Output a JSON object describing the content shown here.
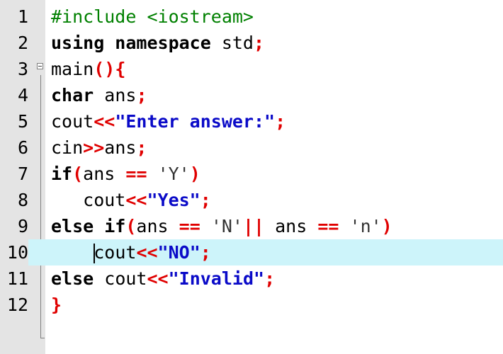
{
  "editor": {
    "current_line": 10,
    "lines": [
      {
        "num": "1",
        "tokens": [
          {
            "t": "pp",
            "v": "#include <iostream>"
          }
        ]
      },
      {
        "num": "2",
        "tokens": [
          {
            "t": "kw",
            "v": "using namespace"
          },
          {
            "t": "plain",
            "v": " std"
          },
          {
            "t": "op",
            "v": ";"
          }
        ]
      },
      {
        "num": "3",
        "tokens": [
          {
            "t": "plain",
            "v": "main"
          },
          {
            "t": "op",
            "v": "(){"
          }
        ]
      },
      {
        "num": "4",
        "tokens": [
          {
            "t": "kw",
            "v": "char"
          },
          {
            "t": "plain",
            "v": " ans"
          },
          {
            "t": "op",
            "v": ";"
          }
        ]
      },
      {
        "num": "5",
        "tokens": [
          {
            "t": "plain",
            "v": "cout"
          },
          {
            "t": "op",
            "v": "<<"
          },
          {
            "t": "str",
            "v": "\"Enter answer:\""
          },
          {
            "t": "op",
            "v": ";"
          }
        ]
      },
      {
        "num": "6",
        "tokens": [
          {
            "t": "plain",
            "v": "cin"
          },
          {
            "t": "op",
            "v": ">>"
          },
          {
            "t": "plain",
            "v": "ans"
          },
          {
            "t": "op",
            "v": ";"
          }
        ]
      },
      {
        "num": "7",
        "tokens": [
          {
            "t": "kw",
            "v": "if"
          },
          {
            "t": "op",
            "v": "("
          },
          {
            "t": "plain",
            "v": "ans "
          },
          {
            "t": "op",
            "v": "=="
          },
          {
            "t": "plain",
            "v": " "
          },
          {
            "t": "chr",
            "v": "'Y'"
          },
          {
            "t": "op",
            "v": ")"
          }
        ]
      },
      {
        "num": "8",
        "tokens": [
          {
            "t": "plain",
            "v": "   cout"
          },
          {
            "t": "op",
            "v": "<<"
          },
          {
            "t": "str",
            "v": "\"Yes\""
          },
          {
            "t": "op",
            "v": ";"
          }
        ]
      },
      {
        "num": "9",
        "tokens": [
          {
            "t": "kw",
            "v": "else if"
          },
          {
            "t": "op",
            "v": "("
          },
          {
            "t": "plain",
            "v": "ans "
          },
          {
            "t": "op",
            "v": "=="
          },
          {
            "t": "plain",
            "v": " "
          },
          {
            "t": "chr",
            "v": "'N'"
          },
          {
            "t": "op",
            "v": "||"
          },
          {
            "t": "plain",
            "v": " ans "
          },
          {
            "t": "op",
            "v": "=="
          },
          {
            "t": "plain",
            "v": " "
          },
          {
            "t": "chr",
            "v": "'n'"
          },
          {
            "t": "op",
            "v": ")"
          }
        ]
      },
      {
        "num": "10",
        "tokens": [
          {
            "t": "plain",
            "v": "    "
          },
          {
            "t": "caret",
            "v": ""
          },
          {
            "t": "plain",
            "v": "cout"
          },
          {
            "t": "op",
            "v": "<<"
          },
          {
            "t": "str",
            "v": "\"NO\""
          },
          {
            "t": "op",
            "v": ";"
          }
        ]
      },
      {
        "num": "11",
        "tokens": [
          {
            "t": "kw",
            "v": "else"
          },
          {
            "t": "plain",
            "v": " cout"
          },
          {
            "t": "op",
            "v": "<<"
          },
          {
            "t": "str",
            "v": "\"Invalid\""
          },
          {
            "t": "op",
            "v": ";"
          }
        ]
      },
      {
        "num": "12",
        "tokens": [
          {
            "t": "op",
            "v": "}"
          }
        ]
      }
    ]
  }
}
